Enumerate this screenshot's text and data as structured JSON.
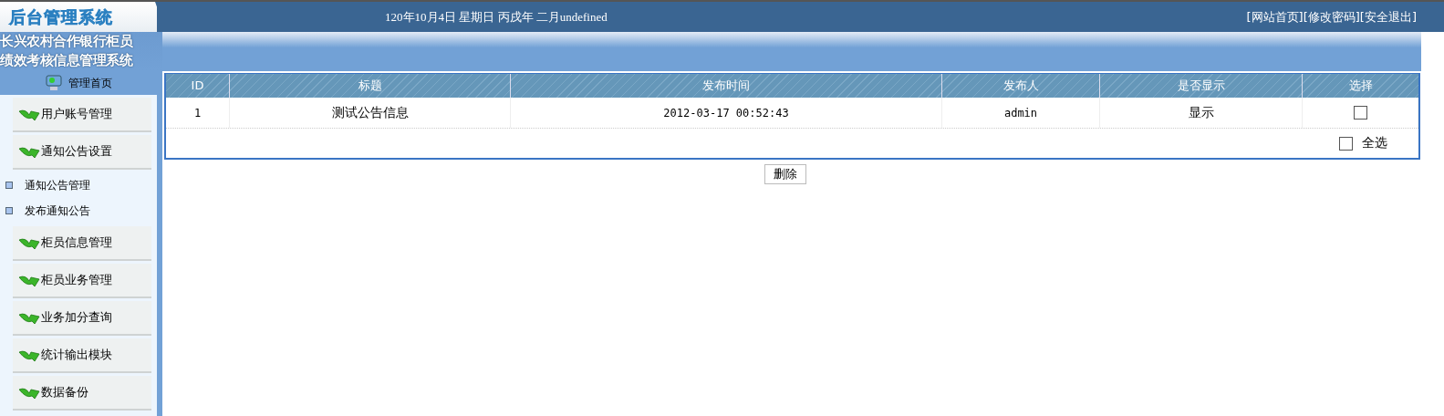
{
  "header": {
    "logo": "后台管理系统",
    "date": "120年10月4日 星期日 丙戌年 二月undefined",
    "links": [
      "[网站首页]",
      "[修改密码]",
      "[安全退出]"
    ],
    "system_title": [
      "长兴农村合作银行柜员",
      "绩效考核信息管理系统"
    ]
  },
  "sidebar": {
    "home": "管理首页",
    "items": [
      {
        "label": "用户账号管理"
      },
      {
        "label": "通知公告设置",
        "children": [
          {
            "label": "通知公告管理"
          },
          {
            "label": "发布通知公告"
          }
        ]
      },
      {
        "label": "柜员信息管理"
      },
      {
        "label": "柜员业务管理"
      },
      {
        "label": "业务加分查询"
      },
      {
        "label": "统计输出模块"
      },
      {
        "label": "数据备份"
      }
    ]
  },
  "table": {
    "columns": [
      "ID",
      "标题",
      "发布时间",
      "发布人",
      "是否显示",
      "选择"
    ],
    "rows": [
      {
        "id": "1",
        "title": "测试公告信息",
        "time": "2012-03-17 00:52:43",
        "author": "admin",
        "display": "显示",
        "checked": false
      }
    ],
    "select_all": {
      "label": "全选",
      "checked": false
    }
  },
  "delete_button": "删除"
}
